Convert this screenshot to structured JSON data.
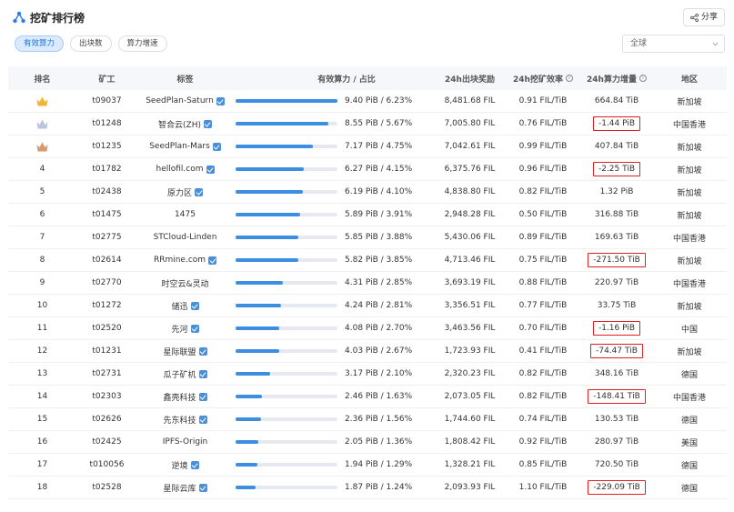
{
  "header": {
    "title": "挖矿排行榜",
    "share_label": "分享"
  },
  "tabs": [
    {
      "label": "有效算力",
      "active": true
    },
    {
      "label": "出块数",
      "active": false
    },
    {
      "label": "算力增速",
      "active": false
    }
  ],
  "region_select": {
    "value": "全球"
  },
  "columns": {
    "rank": "排名",
    "miner": "矿工",
    "tag": "标签",
    "power": "有效算力 / 占比",
    "blocks": "24h出块奖励",
    "efficiency": "24h挖矿效率",
    "growth": "24h算力增量",
    "area": "地区"
  },
  "colors": {
    "accent": "#3b8ee0",
    "highlight_border": "#e02020",
    "gold": "#f2b632",
    "silver": "#b8c7dc",
    "bronze": "#d79a6e"
  },
  "rows": [
    {
      "rank": "",
      "medal": "gold",
      "miner": "t09037",
      "tag": "SeedPlan-Saturn",
      "verified": true,
      "power": "9.40 PiB / 6.23%",
      "share": 1.0,
      "blocks": "8,481.68 FIL",
      "efficiency": "0.91 FIL/TiB",
      "growth": "664.84 TiB",
      "highlight": false,
      "area": "新加坡"
    },
    {
      "rank": "",
      "medal": "silver",
      "miner": "t01248",
      "tag": "智合云(ZH)",
      "verified": true,
      "power": "8.55 PiB / 5.67%",
      "share": 0.91,
      "blocks": "7,005.80 FIL",
      "efficiency": "0.76 FIL/TiB",
      "growth": "-1.44 PiB",
      "highlight": true,
      "area": "中国香港"
    },
    {
      "rank": "",
      "medal": "bronze",
      "miner": "t01235",
      "tag": "SeedPlan-Mars",
      "verified": true,
      "power": "7.17 PiB / 4.75%",
      "share": 0.76,
      "blocks": "7,042.61 FIL",
      "efficiency": "0.99 FIL/TiB",
      "growth": "407.84 TiB",
      "highlight": false,
      "area": "新加坡"
    },
    {
      "rank": "4",
      "medal": "",
      "miner": "t01782",
      "tag": "hellofil.com",
      "verified": true,
      "power": "6.27 PiB / 4.15%",
      "share": 0.67,
      "blocks": "6,375.76 FIL",
      "efficiency": "0.96 FIL/TiB",
      "growth": "-2.25 TiB",
      "highlight": true,
      "area": "新加坡"
    },
    {
      "rank": "5",
      "medal": "",
      "miner": "t02438",
      "tag": "原力区",
      "verified": true,
      "power": "6.19 PiB / 4.10%",
      "share": 0.66,
      "blocks": "4,838.80 FIL",
      "efficiency": "0.82 FIL/TiB",
      "growth": "1.32 PiB",
      "highlight": false,
      "area": "新加坡"
    },
    {
      "rank": "6",
      "medal": "",
      "miner": "t01475",
      "tag": "1475",
      "verified": false,
      "power": "5.89 PiB / 3.91%",
      "share": 0.63,
      "blocks": "2,948.28 FIL",
      "efficiency": "0.50 FIL/TiB",
      "growth": "316.88 TiB",
      "highlight": false,
      "area": "新加坡"
    },
    {
      "rank": "7",
      "medal": "",
      "miner": "t02775",
      "tag": "STCloud-Linden",
      "verified": false,
      "power": "5.85 PiB / 3.88%",
      "share": 0.62,
      "blocks": "5,430.06 FIL",
      "efficiency": "0.89 FIL/TiB",
      "growth": "169.63 TiB",
      "highlight": false,
      "area": "中国香港"
    },
    {
      "rank": "8",
      "medal": "",
      "miner": "t02614",
      "tag": "RRmine.com",
      "verified": true,
      "power": "5.82 PiB / 3.85%",
      "share": 0.62,
      "blocks": "4,713.46 FIL",
      "efficiency": "0.75 FIL/TiB",
      "growth": "-271.50 TiB",
      "highlight": true,
      "area": "新加坡"
    },
    {
      "rank": "9",
      "medal": "",
      "miner": "t02770",
      "tag": "时空云&灵动",
      "verified": false,
      "power": "4.31 PiB / 2.85%",
      "share": 0.46,
      "blocks": "3,693.19 FIL",
      "efficiency": "0.88 FIL/TiB",
      "growth": "220.97 TiB",
      "highlight": false,
      "area": "中国香港"
    },
    {
      "rank": "10",
      "medal": "",
      "miner": "t01272",
      "tag": "储迅",
      "verified": true,
      "power": "4.24 PiB / 2.81%",
      "share": 0.45,
      "blocks": "3,356.51 FIL",
      "efficiency": "0.77 FIL/TiB",
      "growth": "33.75 TiB",
      "highlight": false,
      "area": "新加坡"
    },
    {
      "rank": "11",
      "medal": "",
      "miner": "t02520",
      "tag": "先河",
      "verified": true,
      "power": "4.08 PiB / 2.70%",
      "share": 0.43,
      "blocks": "3,463.56 FIL",
      "efficiency": "0.70 FIL/TiB",
      "growth": "-1.16 PiB",
      "highlight": true,
      "area": "中国"
    },
    {
      "rank": "12",
      "medal": "",
      "miner": "t01231",
      "tag": "星际联盟",
      "verified": true,
      "power": "4.03 PiB / 2.67%",
      "share": 0.43,
      "blocks": "1,723.93 FIL",
      "efficiency": "0.41 FIL/TiB",
      "growth": "-74.47 TiB",
      "highlight": true,
      "area": "新加坡"
    },
    {
      "rank": "13",
      "medal": "",
      "miner": "t02731",
      "tag": "瓜子矿机",
      "verified": true,
      "power": "3.17 PiB / 2.10%",
      "share": 0.34,
      "blocks": "2,320.23 FIL",
      "efficiency": "0.82 FIL/TiB",
      "growth": "348.16 TiB",
      "highlight": false,
      "area": "德国"
    },
    {
      "rank": "14",
      "medal": "",
      "miner": "t02303",
      "tag": "鑫壳科技",
      "verified": true,
      "power": "2.46 PiB / 1.63%",
      "share": 0.26,
      "blocks": "2,073.05 FIL",
      "efficiency": "0.82 FIL/TiB",
      "growth": "-148.41 TiB",
      "highlight": true,
      "area": "中国香港"
    },
    {
      "rank": "15",
      "medal": "",
      "miner": "t02626",
      "tag": "先东科技",
      "verified": true,
      "power": "2.36 PiB / 1.56%",
      "share": 0.25,
      "blocks": "1,744.60 FIL",
      "efficiency": "0.74 FIL/TiB",
      "growth": "130.53 TiB",
      "highlight": false,
      "area": "德国"
    },
    {
      "rank": "16",
      "medal": "",
      "miner": "t02425",
      "tag": "IPFS-Origin",
      "verified": false,
      "power": "2.05 PiB / 1.36%",
      "share": 0.22,
      "blocks": "1,808.42 FIL",
      "efficiency": "0.92 FIL/TiB",
      "growth": "280.97 TiB",
      "highlight": false,
      "area": "美国"
    },
    {
      "rank": "17",
      "medal": "",
      "miner": "t010056",
      "tag": "逆境",
      "verified": true,
      "power": "1.94 PiB / 1.29%",
      "share": 0.21,
      "blocks": "1,328.21 FIL",
      "efficiency": "0.85 FIL/TiB",
      "growth": "720.50 TiB",
      "highlight": false,
      "area": "德国"
    },
    {
      "rank": "18",
      "medal": "",
      "miner": "t02528",
      "tag": "星际云库",
      "verified": true,
      "power": "1.87 PiB / 1.24%",
      "share": 0.2,
      "blocks": "2,093.93 FIL",
      "efficiency": "1.10 FIL/TiB",
      "growth": "-229.09 TiB",
      "highlight": true,
      "area": "德国"
    }
  ]
}
